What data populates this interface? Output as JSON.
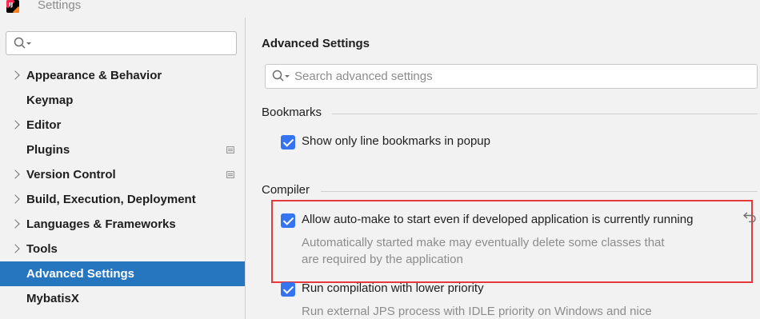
{
  "window": {
    "title": "Settings"
  },
  "sidebar": {
    "search_placeholder": "",
    "items": [
      {
        "label": "Appearance & Behavior",
        "expandable": true,
        "page_icon": false,
        "selected": false
      },
      {
        "label": "Keymap",
        "expandable": false,
        "page_icon": false,
        "selected": false
      },
      {
        "label": "Editor",
        "expandable": true,
        "page_icon": false,
        "selected": false
      },
      {
        "label": "Plugins",
        "expandable": false,
        "page_icon": true,
        "selected": false
      },
      {
        "label": "Version Control",
        "expandable": true,
        "page_icon": true,
        "selected": false
      },
      {
        "label": "Build, Execution, Deployment",
        "expandable": true,
        "page_icon": false,
        "selected": false
      },
      {
        "label": "Languages & Frameworks",
        "expandable": true,
        "page_icon": false,
        "selected": false
      },
      {
        "label": "Tools",
        "expandable": true,
        "page_icon": false,
        "selected": false
      },
      {
        "label": "Advanced Settings",
        "expandable": false,
        "page_icon": false,
        "selected": true
      },
      {
        "label": "MybatisX",
        "expandable": false,
        "page_icon": false,
        "selected": false
      }
    ]
  },
  "main": {
    "title": "Advanced Settings",
    "search": {
      "placeholder": "Search advanced settings",
      "value": ""
    },
    "sections": {
      "bookmarks": {
        "title": "Bookmarks",
        "options": [
          {
            "label": "Show only line bookmarks in popup",
            "checked": true
          }
        ]
      },
      "compiler": {
        "title": "Compiler",
        "options": [
          {
            "label": "Allow auto-make to start even if developed application is currently running",
            "checked": true,
            "hint_line1": "Automatically started make may eventually delete some classes that",
            "hint_line2": "are required by the application"
          },
          {
            "label": "Run compilation with lower priority",
            "checked": true,
            "hint_line1": "Run external JPS process with IDLE priority on Windows and nice"
          }
        ]
      }
    }
  },
  "colors": {
    "selection": "#2675bf",
    "checkbox": "#3574f0",
    "highlight_border": "#e5393c",
    "hint_text": "#8c8c8c"
  },
  "icons": {
    "app": "intellij-idea-icon",
    "search": "search-icon",
    "expand": "chevron-right-icon",
    "page": "project-level-page-icon",
    "reset": "reset-to-default-icon"
  }
}
